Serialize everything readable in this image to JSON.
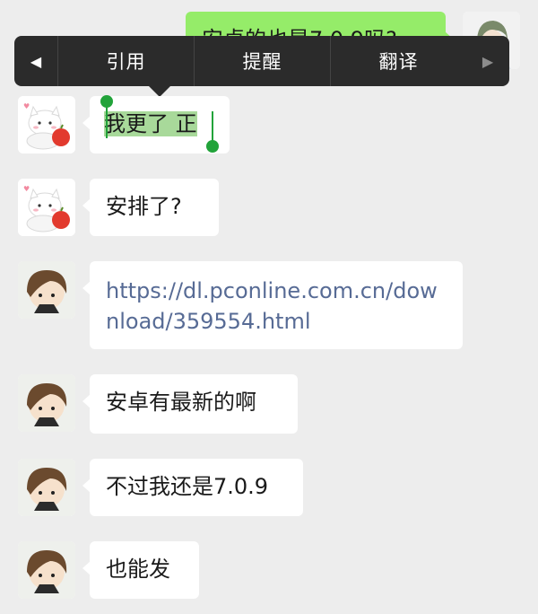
{
  "context_menu": {
    "items": [
      {
        "label": "引用"
      },
      {
        "label": "提醒"
      },
      {
        "label": "翻译"
      }
    ]
  },
  "messages": [
    {
      "text": "安卓的也是7.0.9吗?"
    },
    {
      "text": "我更了 正"
    },
    {
      "text": "安排了?"
    },
    {
      "text": "https://dl.pconline.com.cn/download/359554.html"
    },
    {
      "text": "安卓有最新的啊"
    },
    {
      "text": "不过我还是7.0.9"
    },
    {
      "text": "也能发"
    }
  ],
  "colors": {
    "background": "#ededed",
    "sent_bubble": "#95ec69",
    "link": "#576b95",
    "selection": "#22a33a",
    "menu": "#2b2b2b"
  }
}
